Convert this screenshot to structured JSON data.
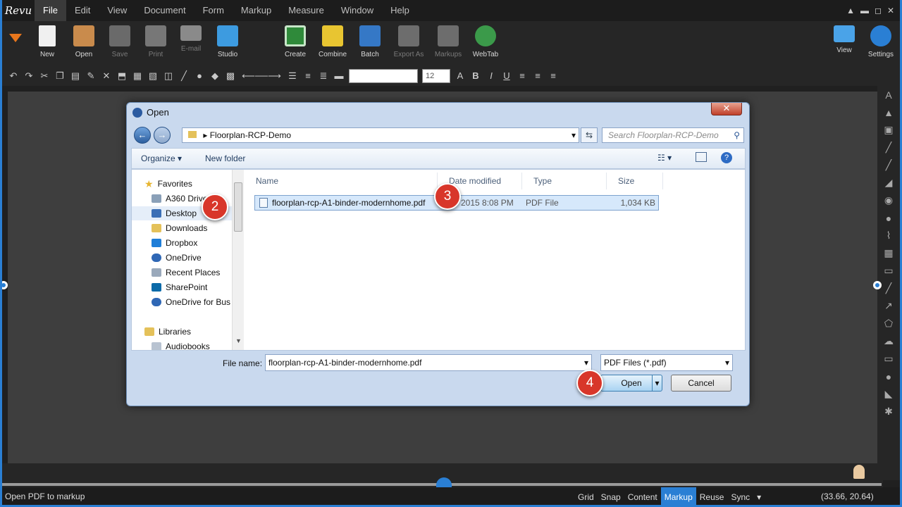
{
  "app": {
    "logo": "Revu"
  },
  "menu": [
    "File",
    "Edit",
    "View",
    "Document",
    "Form",
    "Markup",
    "Measure",
    "Window",
    "Help"
  ],
  "ribbon": [
    {
      "label": "New",
      "dim": false
    },
    {
      "label": "Open",
      "dim": false
    },
    {
      "label": "Save",
      "dim": true
    },
    {
      "label": "Print",
      "dim": true
    },
    {
      "label": "E-mail",
      "dim": true
    },
    {
      "label": "Studio",
      "dim": false
    },
    {
      "label": "Create",
      "dim": false
    },
    {
      "label": "Combine",
      "dim": false
    },
    {
      "label": "Batch",
      "dim": false
    },
    {
      "label": "Export As",
      "dim": true
    },
    {
      "label": "Markups",
      "dim": true
    },
    {
      "label": "WebTab",
      "dim": false
    },
    {
      "label": "View",
      "dim": false
    },
    {
      "label": "Settings",
      "dim": false
    }
  ],
  "toolbar": {
    "font_size": "12"
  },
  "dialog": {
    "title": "Open",
    "path": "Floorplan-RCP-Demo",
    "search_placeholder": "Search Floorplan-RCP-Demo",
    "organize": "Organize",
    "new_folder": "New folder",
    "nav": [
      "Favorites",
      "A360 Drive",
      "Desktop",
      "Downloads",
      "Dropbox",
      "OneDrive",
      "Recent Places",
      "SharePoint",
      "OneDrive for Bus",
      "Libraries",
      "Audiobooks"
    ],
    "columns": [
      "Name",
      "Date modified",
      "Type",
      "Size"
    ],
    "file": {
      "name": "floorplan-rcp-A1-binder-modernhome.pdf",
      "date": "2015 8:08 PM",
      "type": "PDF File",
      "size": "1,034 KB"
    },
    "filename_label": "File name:",
    "filename_value": "floorplan-rcp-A1-binder-modernhome.pdf",
    "filetype": "PDF Files (*.pdf)",
    "open": "Open",
    "cancel": "Cancel"
  },
  "steps": [
    "2",
    "3",
    "4"
  ],
  "status": {
    "text": "Open PDF to markup",
    "tabs": [
      "Grid",
      "Snap",
      "Content",
      "Markup",
      "Reuse",
      "Sync"
    ],
    "active_tab": "Markup",
    "coords": "(33.66, 20.64)"
  }
}
